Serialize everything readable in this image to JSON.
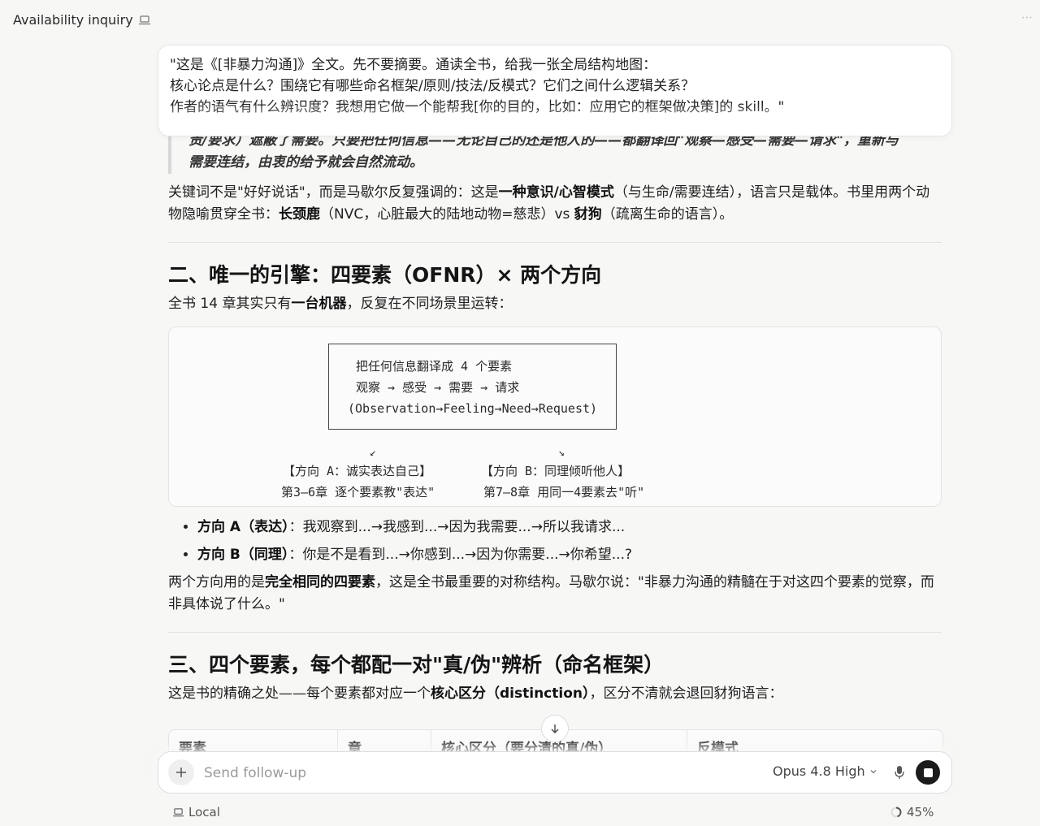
{
  "window": {
    "title": "Availability inquiry",
    "corner_text": "⋯"
  },
  "prompt": {
    "line1": "\"这是《[非暴力沟通]》全文。先不要摘要。通读全书，给我一张全局结构地图：",
    "line2": "核心论点是什么？围绕它有哪些命名框架/原则/技法/反模式？它们之间什么逻辑关系？",
    "line3": "作者的语气有什么辨识度？我想用它做一个能帮我[你的目的，比如：应用它的框架做决策]的 skill。\""
  },
  "article": {
    "quote_line1": "责/要求）遮蔽了需要。只要把任何信息——无论自己的还是他人的——都翻译回\"观察—感受—需要—请求\"，重新与",
    "quote_line2": "需要连结，由衷的给予就会自然流动。",
    "p1": {
      "a": "关键词不是\"好好说话\"，而是马歇尔反复强调的：这是",
      "b": "一种意识/心智模式",
      "c": "（与生命/需要连结），语言只是载体。书里用两个动物隐喻贯穿全书：",
      "d": "长颈鹿",
      "e": "（NVC，心脏最大的陆地动物=慈悲）vs ",
      "f": "豺狗",
      "g": "（疏离生命的语言）。"
    },
    "h2_engine": "二、唯一的引擎：四要素（OFNR）× 两个方向",
    "p2": {
      "a": "全书 14 章其实只有",
      "b": "一台机器",
      "c": "，反复在不同场景里运转："
    },
    "diagram": {
      "l1": "把任何信息翻译成 4 个要素",
      "l2": "观察 → 感受 → 需要 → 请求",
      "l3": "(Observation→Feeling→Need→Request)",
      "arrow_left": "↙",
      "arrow_right": "↘",
      "dir_a_title": "【方向 A：诚实表达自己】",
      "dir_a_sub": "第3–6章 逐个要素教\"表达\"",
      "dir_b_title": "【方向 B：同理倾听他人】",
      "dir_b_sub": "第7–8章 用同一4要素去\"听\""
    },
    "bullets": [
      {
        "label": "方向 A（表达）",
        "text": "：我观察到...→我感到...→因为我需要...→所以我请求..."
      },
      {
        "label": "方向 B（同理）",
        "text": "：你是不是看到...→你感到...→因为你需要...→你希望...?"
      }
    ],
    "p3": {
      "a": "两个方向用的是",
      "b": "完全相同的四要素",
      "c": "，这是全书最重要的对称结构。马歇尔说：\"非暴力沟通的精髓在于对这四个要素的觉察，而非具体说了什么。\""
    },
    "h2_elements": "三、四个要素，每个都配一对\"真/伪\"辨析（命名框架）",
    "p4": {
      "a": "这是书的精确之处——每个要素都对应一个",
      "b": "核心区分（distinction）",
      "c": "，区分不清就会退回豺狗语言："
    },
    "table_headers": [
      "要素",
      "章",
      "核心区分（要分清的真/伪）",
      "反模式"
    ]
  },
  "composer": {
    "placeholder": "Send follow-up",
    "model": "Opus 4.8 High"
  },
  "footer": {
    "location": "Local",
    "progress_label": "45%",
    "progress_value": 45
  },
  "icons": {
    "laptop": "laptop-icon",
    "scroll": "arrow-down-icon",
    "plus": "plus-icon",
    "mic": "microphone-icon",
    "stop": "stop-icon",
    "progress": "progress-ring-icon"
  }
}
